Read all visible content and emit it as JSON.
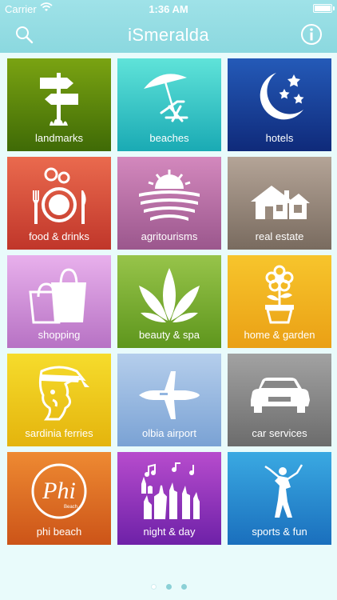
{
  "status_bar": {
    "carrier": "Carrier",
    "time": "1:36 AM"
  },
  "navbar": {
    "title": "iSmeralda",
    "left_icon": "search-icon",
    "right_icon": "info-icon"
  },
  "tiles": [
    {
      "label": "landmarks",
      "icon": "signpost-icon",
      "colors": [
        "#7aa312",
        "#3f6a06"
      ]
    },
    {
      "label": "beaches",
      "icon": "beach-umbrella-icon",
      "colors": [
        "#5fe3d9",
        "#1aaab4"
      ]
    },
    {
      "label": "hotels",
      "icon": "moon-stars-icon",
      "colors": [
        "#245ab8",
        "#0f2a7a"
      ]
    },
    {
      "label": "food & drinks",
      "icon": "plate-cutlery-icon",
      "colors": [
        "#ea6a4e",
        "#c0362a"
      ]
    },
    {
      "label": "agritourisms",
      "icon": "farm-sunrise-icon",
      "colors": [
        "#d388bd",
        "#9b578d"
      ]
    },
    {
      "label": "real estate",
      "icon": "house-icon",
      "colors": [
        "#b4a497",
        "#796b5f"
      ]
    },
    {
      "label": "shopping",
      "icon": "shopping-bags-icon",
      "colors": [
        "#e8b0ec",
        "#b772c4"
      ]
    },
    {
      "label": "beauty & spa",
      "icon": "leaves-icon",
      "colors": [
        "#97c44a",
        "#5e961d"
      ]
    },
    {
      "label": "home & garden",
      "icon": "flower-pot-icon",
      "colors": [
        "#f7c52c",
        "#eaa015"
      ]
    },
    {
      "label": "sardinia ferries",
      "icon": "moor-head-icon",
      "colors": [
        "#f6dc2c",
        "#e4b40d"
      ]
    },
    {
      "label": "olbia airport",
      "icon": "airplane-icon",
      "colors": [
        "#b5ceec",
        "#7aa2d4"
      ]
    },
    {
      "label": "car services",
      "icon": "car-icon",
      "colors": [
        "#a2a2a2",
        "#6c6c6c"
      ]
    },
    {
      "label": "phi beach",
      "icon": "phi-logo-icon",
      "colors": [
        "#ee8a32",
        "#cc5418"
      ]
    },
    {
      "label": "night & day",
      "icon": "music-hands-icon",
      "colors": [
        "#b74ccd",
        "#6e21a8"
      ]
    },
    {
      "label": "sports & fun",
      "icon": "golfer-icon",
      "colors": [
        "#3aa9e2",
        "#1a6fbd"
      ]
    }
  ],
  "pager": {
    "pages": 3,
    "active": 0
  },
  "colors": {
    "header": "#8bd8df",
    "background": "#e9fbfb"
  }
}
